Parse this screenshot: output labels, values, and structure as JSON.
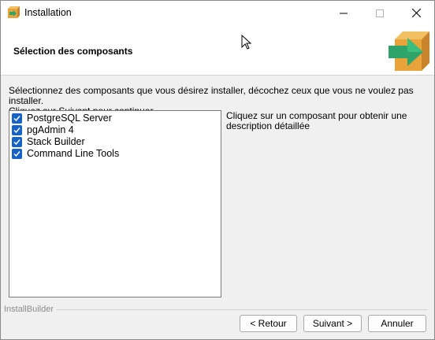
{
  "window": {
    "title": "Installation",
    "controls": {
      "minimize": "minimize-icon",
      "maximize": "maximize-icon",
      "close": "close-icon"
    }
  },
  "header": {
    "title": "Sélection des composants",
    "logo": "installer-box-arrow-icon"
  },
  "instructions": {
    "line1": "Sélectionnez des composants que vous désirez installer, décochez ceux que vous ne voulez pas installer.",
    "line2": "Cliquez sur Suivant pour continuer."
  },
  "components": [
    {
      "label": "PostgreSQL Server",
      "checked": true
    },
    {
      "label": "pgAdmin 4",
      "checked": true
    },
    {
      "label": "Stack Builder",
      "checked": true
    },
    {
      "label": "Command Line Tools",
      "checked": true
    }
  ],
  "description": {
    "text": "Cliquez sur un composant pour obtenir une description détaillée"
  },
  "footer": {
    "brand": "InstallBuilder",
    "back_label": "< Retour",
    "next_label": "Suivant >",
    "cancel_label": "Annuler"
  },
  "colors": {
    "checkbox": "#1662c6",
    "logo_box": "#e8a33a",
    "logo_arrow": "#2ea36a"
  }
}
